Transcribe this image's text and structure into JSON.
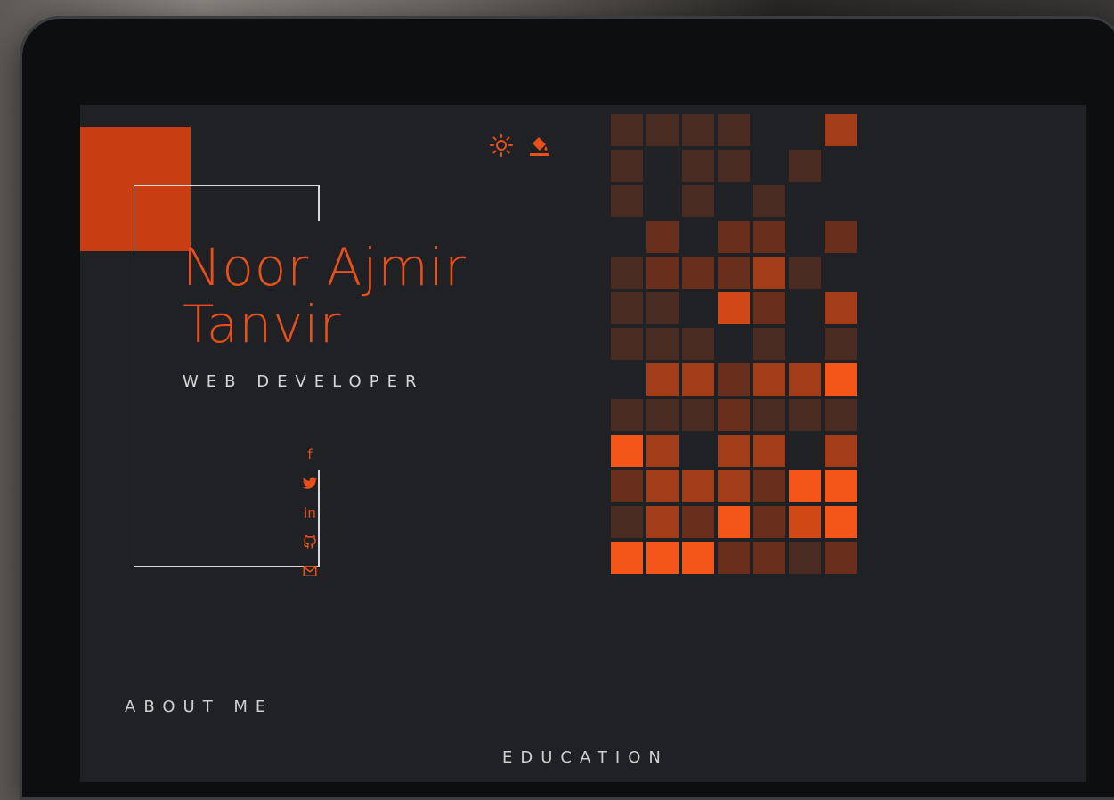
{
  "hero": {
    "name_line1": "Noor Ajmir",
    "name_line2": "Tanvir",
    "role": "WEB DEVELOPER"
  },
  "header": {
    "icons": [
      "sun-icon",
      "paint-bucket-icon"
    ]
  },
  "social": {
    "items": [
      {
        "icon": "facebook-icon",
        "glyph": "f"
      },
      {
        "icon": "twitter-icon"
      },
      {
        "icon": "linkedin-icon",
        "glyph": "in"
      },
      {
        "icon": "github-icon"
      },
      {
        "icon": "email-icon"
      }
    ]
  },
  "nav": {
    "about": "ABOUT ME",
    "education": "EDUCATION"
  },
  "colors": {
    "accent": "#e8501b",
    "accent_dark": "#c93d13",
    "screen_bg": "#202124",
    "frame_line": "#d9d9d9"
  },
  "mosaic": {
    "rows": [
      [
        1,
        1,
        1,
        1,
        0,
        0,
        3,
        0
      ],
      [
        1,
        0,
        1,
        1,
        0,
        1,
        0,
        0
      ],
      [
        1,
        0,
        1,
        0,
        1,
        0,
        0,
        0
      ],
      [
        0,
        2,
        0,
        2,
        2,
        0,
        2,
        0
      ],
      [
        1,
        2,
        2,
        2,
        3,
        1,
        0,
        0
      ],
      [
        1,
        1,
        0,
        4,
        2,
        0,
        3,
        0
      ],
      [
        1,
        1,
        1,
        0,
        1,
        0,
        1,
        0
      ],
      [
        0,
        3,
        3,
        2,
        3,
        3,
        5,
        0
      ],
      [
        1,
        1,
        1,
        2,
        1,
        1,
        1,
        0
      ],
      [
        5,
        3,
        0,
        3,
        3,
        0,
        3,
        0
      ],
      [
        2,
        3,
        3,
        3,
        2,
        5,
        5,
        0
      ],
      [
        1,
        3,
        2,
        5,
        2,
        4,
        5,
        0
      ],
      [
        5,
        5,
        5,
        2,
        2,
        1,
        2,
        0
      ]
    ],
    "palette": [
      "transparent",
      "#4a2b22",
      "#6a2f1c",
      "#a33c18",
      "#cf4815",
      "#f4561a"
    ]
  }
}
